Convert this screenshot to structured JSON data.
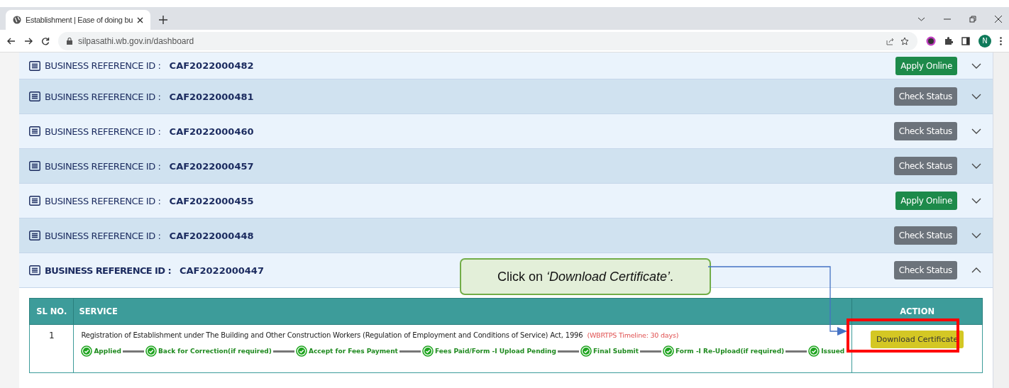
{
  "browser": {
    "tab_title": "Establishment | Ease of doing bu",
    "url": "silpasathi.wb.gov.in/dashboard",
    "avatar": "N"
  },
  "references": [
    {
      "label": "BUSINESS REFERENCE ID :",
      "id": "CAF2022000482",
      "action": {
        "kind": "apply",
        "label": "Apply Online"
      },
      "expanded": false
    },
    {
      "label": "BUSINESS REFERENCE ID :",
      "id": "CAF2022000481",
      "action": {
        "kind": "check",
        "label": "Check Status"
      },
      "expanded": false
    },
    {
      "label": "BUSINESS REFERENCE ID :",
      "id": "CAF2022000460",
      "action": {
        "kind": "check",
        "label": "Check Status"
      },
      "expanded": false
    },
    {
      "label": "BUSINESS REFERENCE ID :",
      "id": "CAF2022000457",
      "action": {
        "kind": "check",
        "label": "Check Status"
      },
      "expanded": false
    },
    {
      "label": "BUSINESS REFERENCE ID :",
      "id": "CAF2022000455",
      "action": {
        "kind": "apply",
        "label": "Apply Online"
      },
      "expanded": false
    },
    {
      "label": "BUSINESS REFERENCE ID :",
      "id": "CAF2022000448",
      "action": {
        "kind": "check",
        "label": "Check Status"
      },
      "expanded": false
    },
    {
      "label": "BUSINESS REFERENCE ID :",
      "id": "CAF2022000447",
      "action": {
        "kind": "check",
        "label": "Check Status"
      },
      "expanded": true
    }
  ],
  "table": {
    "columns": [
      "SL NO.",
      "SERVICE",
      "ACTION"
    ],
    "rows": [
      {
        "sl": "1",
        "service": "Registration of Establishment under The Building and Other Construction Workers (Regulation of Employment and Conditions of Service) Act, 1996",
        "timeline": "(WBRTPS Timeline: 30 days)",
        "steps": [
          "Applied",
          "Back for Correction(if required)",
          "Accept for Fees Payment",
          "Fees Paid/Form -I Upload Pending",
          "Final Submit",
          "Form -I Re-Upload(if required)",
          "Issued"
        ],
        "action": "Download Certificate"
      }
    ]
  },
  "callout": "Click on *‘Download Certificate’*."
}
